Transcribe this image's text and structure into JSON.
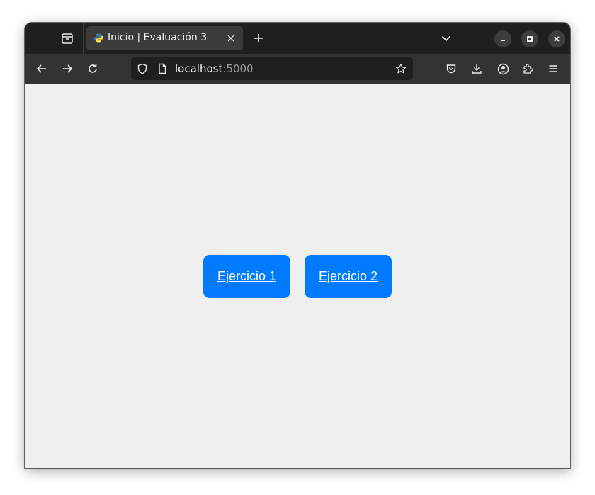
{
  "browser": {
    "tab": {
      "title": "Inicio | Evaluación 3"
    },
    "urlbar": {
      "host": "localhost",
      "port": ":5000"
    },
    "icons": {
      "tab_list": "tab-list-icon",
      "favicon": "python-favicon-icon",
      "tab_close": "close-icon",
      "new_tab": "plus-icon",
      "tabs_dropdown": "chevron-down-icon",
      "minimize": "minimize-icon",
      "maximize": "maximize-icon",
      "close_window": "close-window-icon",
      "back": "arrow-left-icon",
      "forward": "arrow-right-icon",
      "reload": "reload-icon",
      "tracking_protection": "shield-icon",
      "page_info": "page-icon",
      "bookmark": "star-icon",
      "pocket": "pocket-icon",
      "downloads": "download-icon",
      "account": "account-icon",
      "extensions": "puzzle-icon",
      "menu": "hamburger-menu-icon"
    }
  },
  "page": {
    "buttons": [
      {
        "label": "Ejercicio 1"
      },
      {
        "label": "Ejercicio 2"
      }
    ],
    "colors": {
      "button_bg": "#007bff",
      "button_text": "#ffffff",
      "page_bg": "#efefef"
    }
  }
}
